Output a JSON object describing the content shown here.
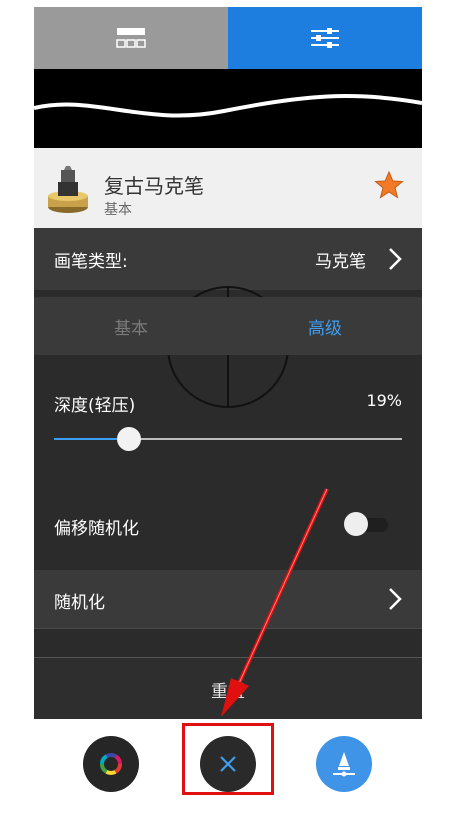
{
  "tabs": [
    {
      "icon": "brush-grid-icon",
      "active": false
    },
    {
      "icon": "sliders-icon",
      "active": true
    }
  ],
  "brush": {
    "title": "复古马克笔",
    "subtitle": "基本",
    "favorite": true,
    "icon": "marker-icon"
  },
  "brush_type": {
    "label": "画笔类型:",
    "value": "马克笔"
  },
  "segments": {
    "basic": "基本",
    "advanced": "高级",
    "selected": "advanced"
  },
  "depth": {
    "label": "深度(轻压)",
    "value_text": "19%",
    "value": 0.19
  },
  "offset_random": {
    "label": "偏移随机化",
    "enabled": false
  },
  "randomize": {
    "label": "随机化"
  },
  "reset": {
    "label": "重置"
  },
  "bottom_buttons": [
    {
      "icon": "color-wheel-icon"
    },
    {
      "icon": "close-icon",
      "highlighted": true
    },
    {
      "icon": "brush-settings-icon"
    }
  ],
  "colors": {
    "accent": "#3d9df0",
    "tab_active": "#1e7ee0",
    "highlight": "#e01010",
    "star": "#f07a28"
  }
}
